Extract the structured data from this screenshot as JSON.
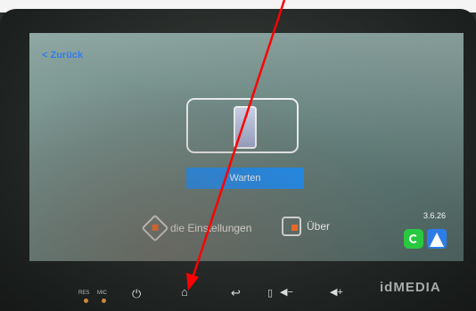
{
  "screen": {
    "back_label": "< Zurück",
    "warten_label": "Warten",
    "settings_label": "die Einstellungen",
    "about_label": "Über",
    "version": "3.6.26"
  },
  "controls": {
    "res_label": "RES",
    "mic_label": "MIC"
  },
  "brand": "idMEDIA",
  "colors": {
    "accent_blue": "#1a8cf0",
    "orange_dot": "#ff6a1f",
    "annotation_red": "#ff0000"
  }
}
